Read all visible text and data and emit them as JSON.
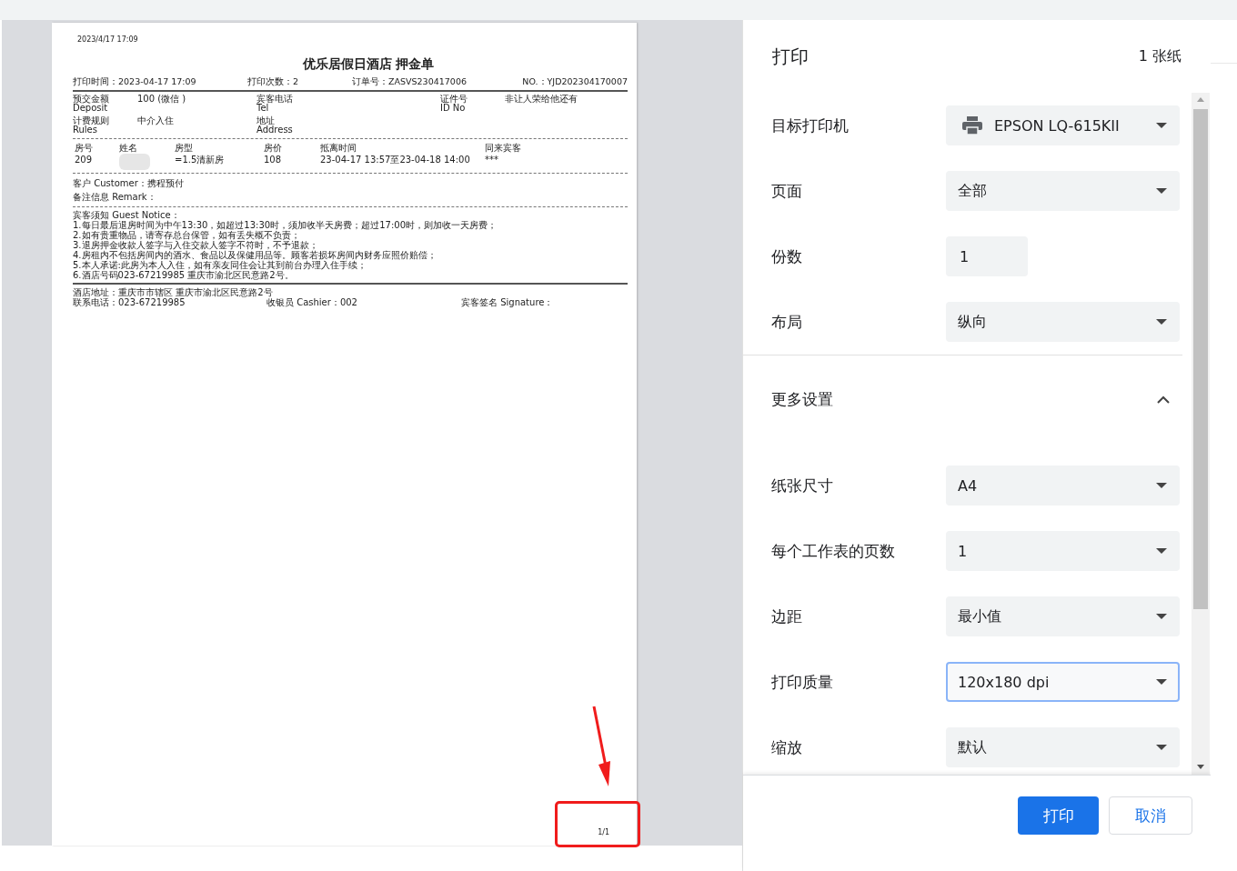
{
  "preview": {
    "timestamp": "2023/4/17 17:09",
    "title": "优乐居假日酒店 押金单",
    "meta": [
      "打印时间：2023-04-17 17:09",
      "打印次数：2",
      "订单号：ZASVS230417006",
      "NO.：YJD202304170007"
    ],
    "info_rows": [
      [
        {
          "cn": "预交金额",
          "en": "Deposit",
          "value": "100 (微信 )"
        },
        {
          "cn": "宾客电话",
          "en": "Tel"
        },
        {
          "cn": "证件号",
          "en": "ID No",
          "value": "非让人荣给他还有"
        }
      ],
      [
        {
          "cn": "计费规则",
          "en": "Rules",
          "value": "中介入住"
        },
        {
          "cn": "地址",
          "en": "Address"
        }
      ]
    ],
    "room_columns": [
      {
        "header": "房号",
        "value": "209"
      },
      {
        "header": "姓名"
      },
      {
        "header": "房型",
        "value": "=1.5清新房"
      },
      {
        "header": "房价",
        "value": "108"
      },
      {
        "header": "抵离时间",
        "value": "23-04-17 13:57至23-04-18 14:00"
      },
      {
        "header": "同来宾客",
        "value": "***"
      }
    ],
    "customer": "客户 Customer：携程预付",
    "remark": "备注信息 Remark：",
    "notice_title": "宾客须知 Guest Notice：",
    "notices": [
      "1.每日最后退房时间为中午13:30，如超过13:30时，须加收半天房费；超过17:00时，则加收一天房费；",
      "2.如有贵重物品，请寄存总台保管，如有丢失概不负责；",
      "3.退房押金收款人签字与入住交款人签字不符时，不予退款；",
      "4.房租内不包括房间内的酒水、食品以及保健用品等。顾客若损坏房间内财务应照价赔偿；",
      "5.本人承诺:此房为本人入住，如有亲友同住会让其到前台办理入住手续；",
      "6.酒店号码023-67219985 重庆市渝北区民意路2号。"
    ],
    "address": "酒店地址：重庆市市辖区 重庆市渝北区民意路2号",
    "footer": [
      "联系电话：023-67219985",
      "收银员 Cashier：002",
      "宾客签名 Signature："
    ],
    "page_number": "1/1"
  },
  "panel": {
    "title": "打印",
    "sheets": "1 张纸",
    "settings": [
      {
        "kind": "dropdown",
        "label": "目标打印机",
        "value": "EPSON LQ-615KII",
        "printer_icon": true,
        "focused": false
      },
      {
        "kind": "dropdown",
        "label": "页面",
        "value": "全部",
        "printer_icon": false,
        "focused": false
      },
      {
        "kind": "input",
        "label": "份数",
        "value": "1",
        "focused": false
      },
      {
        "kind": "dropdown",
        "label": "布局",
        "value": "纵向",
        "printer_icon": false,
        "focused": false
      },
      {
        "kind": "section",
        "label": "更多设置",
        "expanded": true
      },
      {
        "kind": "dropdown",
        "label": "纸张尺寸",
        "value": "A4",
        "printer_icon": false,
        "focused": false
      },
      {
        "kind": "dropdown",
        "label": "每个工作表的页数",
        "value": "1",
        "printer_icon": false,
        "focused": false
      },
      {
        "kind": "dropdown",
        "label": "边距",
        "value": "最小值",
        "printer_icon": false,
        "focused": false
      },
      {
        "kind": "dropdown",
        "label": "打印质量",
        "value": "120x180 dpi",
        "printer_icon": false,
        "focused": true
      },
      {
        "kind": "dropdown",
        "label": "缩放",
        "value": "默认",
        "printer_icon": false,
        "focused": false
      }
    ],
    "buttons": [
      {
        "kind": "primary",
        "label": "打印"
      },
      {
        "kind": "secondary",
        "label": "取消"
      }
    ]
  }
}
